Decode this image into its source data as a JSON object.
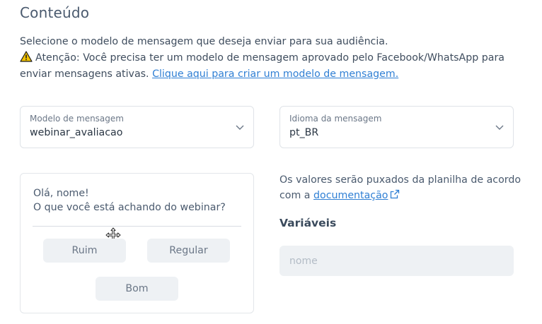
{
  "section": {
    "title": "Conteúdo"
  },
  "intro": {
    "line1": "Selecione o modelo de mensagem que deseja enviar para sua audiência.",
    "warning": "Atenção: Você precisa ter um modelo de mensagem aprovado pelo Facebook/WhatsApp para enviar mensagens ativas.",
    "link": "Clique aqui para criar um modelo de mensagem."
  },
  "template_select": {
    "label": "Modelo de mensagem",
    "value": "webinar_avaliacao"
  },
  "language_select": {
    "label": "Idioma da mensagem",
    "value": "pt_BR"
  },
  "preview": {
    "greeting": "Olá, nome!",
    "question": "O que você está achando do webinar?",
    "buttons": [
      "Ruim",
      "Regular",
      "Bom"
    ]
  },
  "info": {
    "text": "Os valores serão puxados da planilha de acordo com a",
    "link": "documentação"
  },
  "variables": {
    "title": "Variáveis",
    "placeholder": "nome"
  },
  "colors": {
    "accent_link": "#2f7fd4",
    "warning": "#f2c200",
    "field_bg": "#eef1f4"
  }
}
